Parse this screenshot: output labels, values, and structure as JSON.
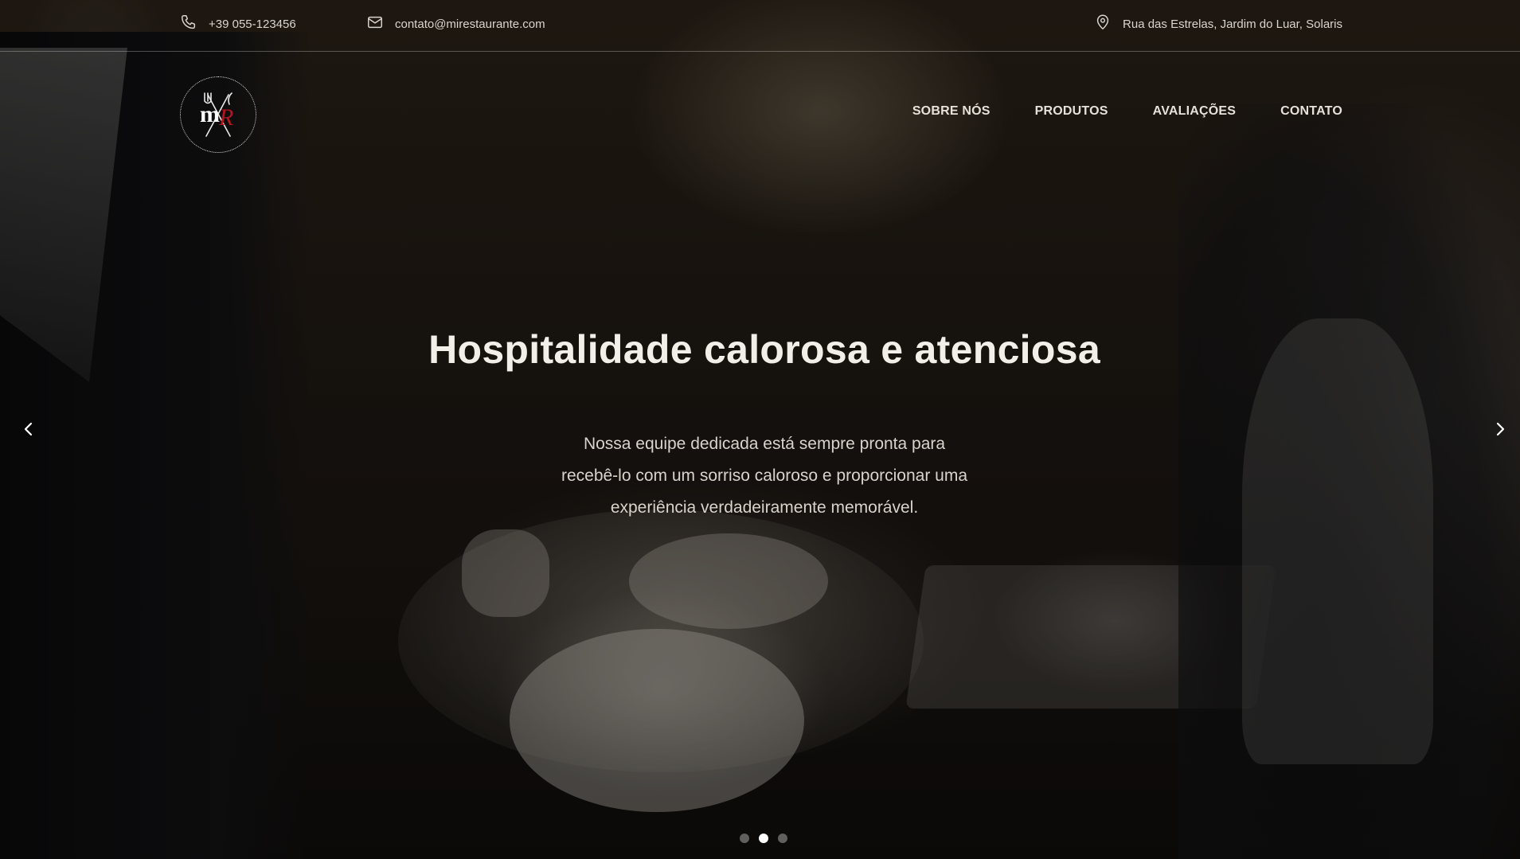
{
  "topbar": {
    "phone": "+39 055-123456",
    "email": "contato@mirestaurante.com",
    "address": "Rua das Estrelas, Jardim do Luar, Solaris",
    "icons": {
      "phone": "phone-icon",
      "email": "mail-icon",
      "address": "map-pin-icon"
    }
  },
  "logo": {
    "text_m": "m",
    "text_r": "R",
    "accent": "#b3141e"
  },
  "nav": {
    "items": [
      {
        "label": "SOBRE NÓS"
      },
      {
        "label": "PRODUTOS"
      },
      {
        "label": "AVALIAÇÕES"
      },
      {
        "label": "CONTATO"
      }
    ]
  },
  "slider": {
    "headline": "Hospitalidade calorosa e atenciosa",
    "description": "Nossa equipe dedicada está sempre pronta para recebê-lo com um sorriso caloroso e proporcionar uma experiência verdadeiramente memorável.",
    "prev_icon": "chevron-left-icon",
    "next_icon": "chevron-right-icon",
    "slide_count": 3,
    "active_slide": 2
  }
}
